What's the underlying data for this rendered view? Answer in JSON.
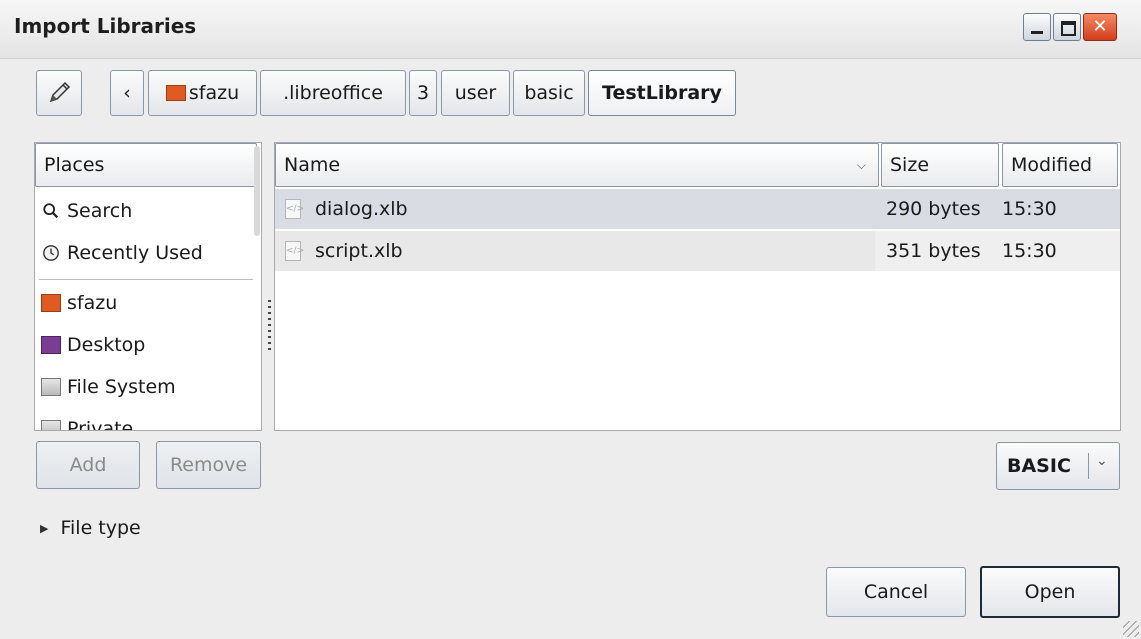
{
  "window": {
    "title": "Import Libraries",
    "controls": [
      "minimize",
      "maximize",
      "close"
    ]
  },
  "toolbar": {
    "edit_icon": "pencil-icon",
    "back_label": "‹",
    "path": [
      ".libreoffice",
      "3",
      "user",
      "basic"
    ],
    "home_crumb": "sfazu",
    "current_crumb": "TestLibrary"
  },
  "places": {
    "header": "Places",
    "items": [
      {
        "label": "Search",
        "icon": "search-icon"
      },
      {
        "label": "Recently Used",
        "icon": "clock-icon"
      },
      {
        "label": "sfazu",
        "icon": "home-folder-icon"
      },
      {
        "label": "Desktop",
        "icon": "desktop-icon"
      },
      {
        "label": "File System",
        "icon": "drive-icon"
      },
      {
        "label": "Private",
        "icon": "drive-icon"
      }
    ]
  },
  "files": {
    "columns": {
      "name": "Name",
      "size": "Size",
      "modified": "Modified"
    },
    "rows": [
      {
        "name": "dialog.xlb",
        "size": "290 bytes",
        "modified": "15:30"
      },
      {
        "name": "script.xlb",
        "size": "351 bytes",
        "modified": "15:30"
      }
    ]
  },
  "buttons": {
    "add": "Add",
    "remove": "Remove",
    "cancel": "Cancel",
    "open": "Open"
  },
  "filter": {
    "selected": "BASIC"
  },
  "file_type": {
    "label": "File type"
  },
  "colors": {
    "selected_row": "#d9dde3",
    "hover_row": "#e8e8e8",
    "close_button": "#d8411f",
    "home_folder": "#e05a23",
    "desktop": "#7a3d93"
  }
}
